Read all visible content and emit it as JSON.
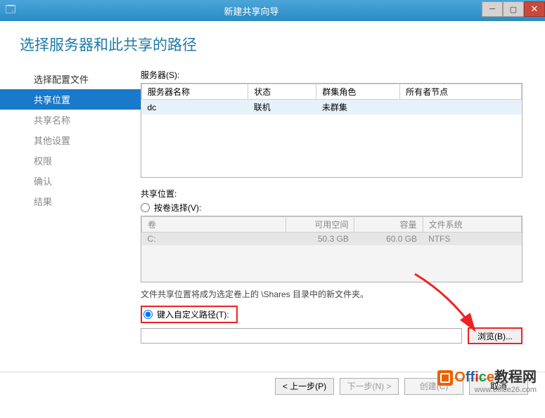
{
  "window": {
    "title": "新建共享向导",
    "min": "─",
    "max": "▢",
    "close": "✕"
  },
  "pageTitle": "选择服务器和此共享的路径",
  "nav": {
    "items": [
      {
        "label": "选择配置文件",
        "state": "done"
      },
      {
        "label": "共享位置",
        "state": "active"
      },
      {
        "label": "共享名称",
        "state": "disabled"
      },
      {
        "label": "其他设置",
        "state": "disabled"
      },
      {
        "label": "权限",
        "state": "disabled"
      },
      {
        "label": "确认",
        "state": "disabled"
      },
      {
        "label": "结果",
        "state": "disabled"
      }
    ]
  },
  "server": {
    "label": "服务器(S):",
    "headers": [
      "服务器名称",
      "状态",
      "群集角色",
      "所有者节点"
    ],
    "row": [
      "dc",
      "联机",
      "未群集",
      ""
    ]
  },
  "shareLoc": {
    "label": "共享位置:"
  },
  "volume": {
    "radioLabel": "按卷选择(V):",
    "headers": [
      "卷",
      "可用空间",
      "容量",
      "文件系统"
    ],
    "row": [
      "C:",
      "50.3 GB",
      "60.0 GB",
      "NTFS"
    ],
    "hint": "文件共享位置将成为选定卷上的 \\Shares 目录中的新文件夹。"
  },
  "custom": {
    "radioLabel": "键入自定义路径(T):",
    "browse": "浏览(B)..."
  },
  "footer": {
    "prev": "< 上一步(P)",
    "next": "下一步(N) >",
    "create": "创建(C)",
    "cancel": "取消"
  },
  "watermark": {
    "brand": "Office教程网",
    "url": "www.office26.com"
  }
}
